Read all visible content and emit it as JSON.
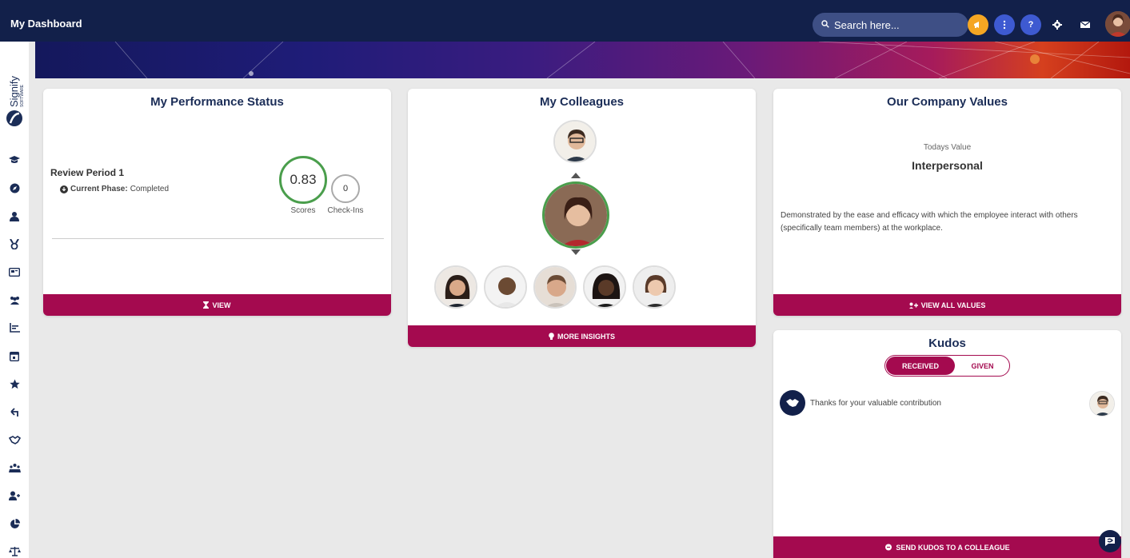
{
  "app": {
    "title": "My Dashboard"
  },
  "search": {
    "placeholder": "Search here..."
  },
  "topbar_icons": [
    "megaphone-icon",
    "more-icon",
    "help-icon",
    "gear-icon",
    "mail-icon"
  ],
  "help_label": "?",
  "performance": {
    "title": "My Performance Status",
    "period": "Review Period 1",
    "phase_label": "Current Phase:",
    "phase_value": "Completed",
    "score_value": "0.83",
    "score_label": "Scores",
    "checkins_value": "0",
    "checkins_label": "Check-Ins",
    "button": "VIEW"
  },
  "colleagues": {
    "title": "My Colleagues",
    "button": "MORE INSIGHTS"
  },
  "values": {
    "title": "Our Company Values",
    "todays_label": "Todays Value",
    "value_name": "Interpersonal",
    "description": "Demonstrated by the ease and efficacy with which the employee interact with others (specifically team members) at the workplace.",
    "button": "VIEW ALL VALUES"
  },
  "kudos": {
    "title": "Kudos",
    "tab_received": "RECEIVED",
    "tab_given": "GIVEN",
    "message": "Thanks for your valuable contribution",
    "button": "SEND KUDOS TO A COLLEAGUE"
  },
  "brand": {
    "name": "Signify",
    "sub": "SOFTWARE"
  },
  "colors": {
    "navy": "#12204a",
    "accent": "#a40a4f",
    "score_ring": "#4a9e4c",
    "megaphone": "#f5a623"
  }
}
